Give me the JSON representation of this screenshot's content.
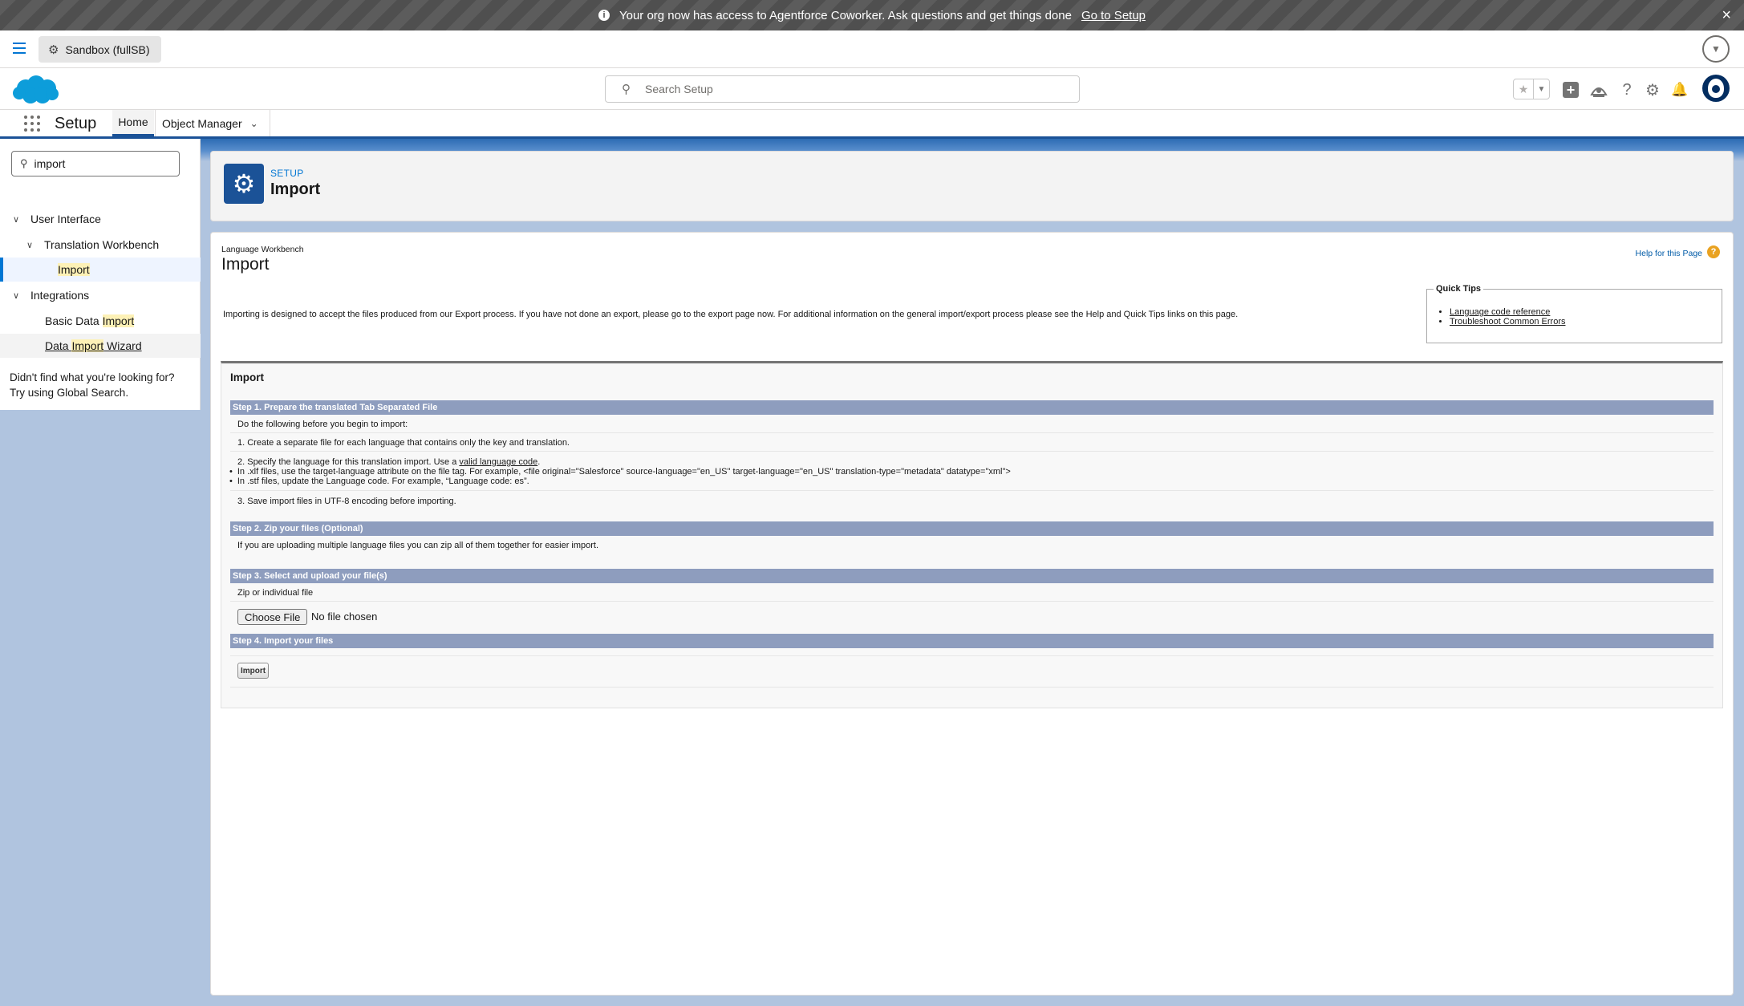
{
  "banner": {
    "message": "Your org now has access to Agentforce Coworker. Ask questions and get things done",
    "link": "Go to Setup",
    "close": "×"
  },
  "org": {
    "sandbox_label": "Sandbox (fullSB)"
  },
  "search": {
    "placeholder": "Search Setup"
  },
  "nav": {
    "app_name": "Setup",
    "tabs": [
      {
        "label": "Home"
      },
      {
        "label": "Object Manager"
      }
    ]
  },
  "sidebar": {
    "quickfind_value": "import",
    "tree": [
      {
        "label": "User Interface"
      },
      {
        "label": "Translation Workbench"
      },
      {
        "label": "Import"
      },
      {
        "label": "Integrations"
      },
      {
        "label_prefix": "Basic Data ",
        "label_highlight": "Import"
      },
      {
        "label_prefix": "Data ",
        "label_highlight": "Import",
        "label_suffix": " Wizard"
      }
    ],
    "not_found_line1": "Didn't find what you're looking for?",
    "not_found_line2": "Try using Global Search."
  },
  "header": {
    "eyebrow": "SETUP",
    "title": "Import"
  },
  "main": {
    "eyebrow": "Language Workbench",
    "title": "Import",
    "help_link": "Help for this Page",
    "intro": "Importing is designed to accept the files produced from our Export process. If you have not done an export, please go to the export page now. For additional information on the general import/export process please see the Help and Quick Tips links on this page.",
    "quick_tips": {
      "title": "Quick Tips",
      "links": [
        "Language code reference",
        "Troubleshoot Common Errors"
      ]
    },
    "panel_title": "Import",
    "step1": {
      "title": "Step 1. Prepare the translated Tab Separated File",
      "intro": "Do the following before you begin to import:",
      "item1": "1. Create a separate file for each language that contains only the key and translation.",
      "item2_prefix": "2. Specify the language for this translation import. Use a ",
      "item2_link": "valid language code",
      "item2_suffix": ".",
      "bullet1": "In .xlf files, use the target-language attribute on the file tag. For example, <file original=\"Salesforce\" source-language=\"en_US\" target-language=\"en_US\" translation-type=\"metadata\" datatype=\"xml\">",
      "bullet2": "In .stf files, update the Language code. For example, “Language code: es”.",
      "item3": "3. Save import files in UTF-8 encoding before importing."
    },
    "step2": {
      "title": "Step 2. Zip your files (Optional)",
      "text": "If you are uploading multiple language files you can zip all of them together for easier import."
    },
    "step3": {
      "title": "Step 3. Select and upload your file(s)",
      "label": "Zip or individual file",
      "choose_button": "Choose File",
      "no_file": "No file chosen"
    },
    "step4": {
      "title": "Step 4. Import your files",
      "button": "Import"
    }
  }
}
